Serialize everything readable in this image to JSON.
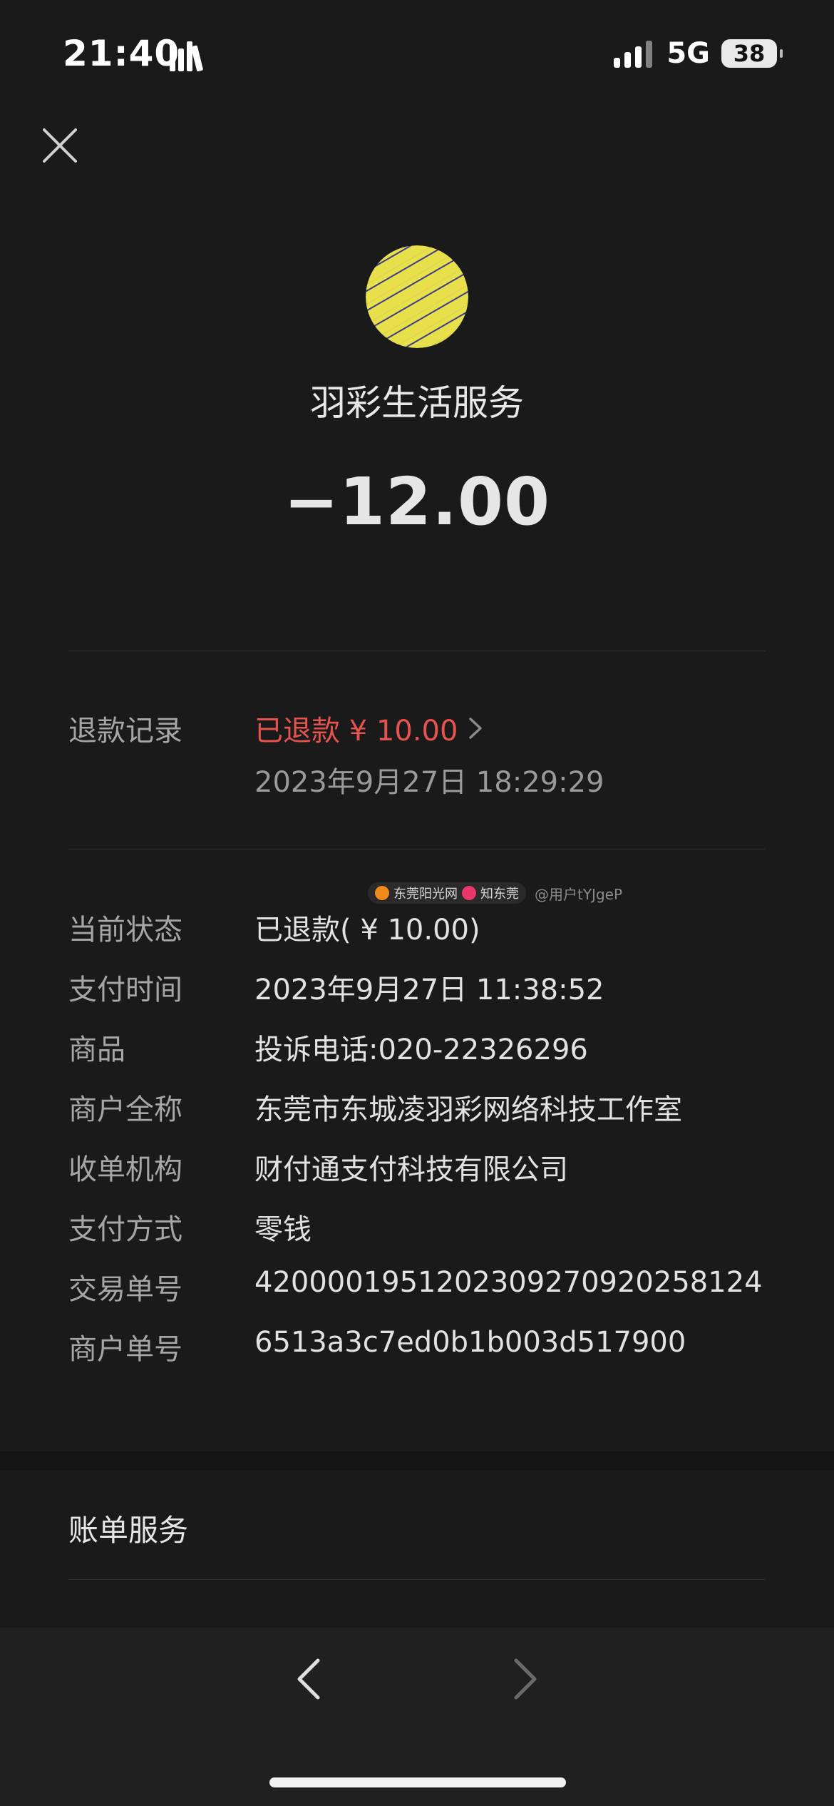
{
  "status_bar": {
    "time": "21:40",
    "network": "5G",
    "battery": "38"
  },
  "merchant": {
    "name": "羽彩生活服务",
    "amount": "−12.00"
  },
  "refund": {
    "label": "退款记录",
    "status": "已退款 ¥ 10.00",
    "time": "2023年9月27日 18:29:29"
  },
  "watermark": {
    "brand1": "东莞阳光网",
    "brand2": "知东莞",
    "user": "@用户tYJgeP"
  },
  "details": [
    {
      "label": "当前状态",
      "value": "已退款( ¥ 10.00)"
    },
    {
      "label": "支付时间",
      "value": "2023年9月27日 11:38:52"
    },
    {
      "label": "商品",
      "value": "投诉电话:020-22326296"
    },
    {
      "label": "商户全称",
      "value": "东莞市东城凌羽彩网络科技工作室"
    },
    {
      "label": "收单机构",
      "value": "财付通支付科技有限公司"
    },
    {
      "label": "支付方式",
      "value": "零钱"
    },
    {
      "label": "交易单号",
      "value": "4200001951202309270920258124"
    },
    {
      "label": "商户单号",
      "value": "6513a3c7ed0b1b003d517900"
    }
  ],
  "bill_service": {
    "label": "账单服务"
  },
  "colors": {
    "background": "#1a1a1b",
    "refund_red": "#e5534f",
    "logo_yellow": "#e8e04a",
    "logo_purple": "#3b3a8c"
  },
  "icons": {
    "close": "close-icon",
    "chevron_right": "chevron-right-icon",
    "back": "chevron-left-icon",
    "forward": "chevron-right-icon"
  }
}
